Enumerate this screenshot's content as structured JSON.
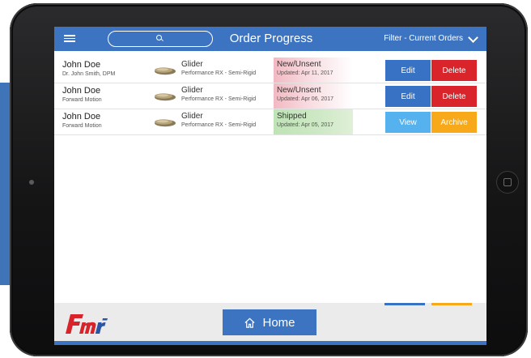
{
  "header": {
    "title": "Order Progress",
    "search_placeholder": "",
    "filter_label": "Filter - Current Orders"
  },
  "orders": [
    {
      "patient": "John Doe",
      "practice": "Dr. John Smith, DPM",
      "product": "Glider",
      "product_detail": "Performance RX - Semi-Rigid",
      "status": "New/Unsent",
      "updated": "Updated: Apr 11, 2017",
      "action_1": "Edit",
      "action_2": "Delete"
    },
    {
      "patient": "John Doe",
      "practice": "Forward Motion",
      "product": "Glider",
      "product_detail": "Performance RX - Semi-Rigid",
      "status": "New/Unsent",
      "updated": "Updated: Apr 06, 2017",
      "action_1": "Edit",
      "action_2": "Delete"
    },
    {
      "patient": "John Doe",
      "practice": "Forward Motion",
      "product": "Glider",
      "product_detail": "Performance RX - Semi-Rigid",
      "status": "Shipped",
      "updated": "Updated: Apr 05, 2017",
      "action_1": "View",
      "action_2": "Archive"
    }
  ],
  "footer": {
    "home_label": "Home",
    "logo_icon": "fmr-logo"
  },
  "colors": {
    "header_blue": "#3d74c2",
    "edit_blue": "#3772c4",
    "delete_red": "#d9242b",
    "view_blue": "#55b2ee",
    "archive_orange": "#f7a91a",
    "status_new": "#f2b9c2",
    "status_shipped": "#bfe3b6"
  },
  "icons": {
    "menu": "hamburger-icon",
    "search": "search-icon",
    "filter": "chevron-down-icon",
    "home": "home-icon",
    "product": "insole-icon"
  }
}
